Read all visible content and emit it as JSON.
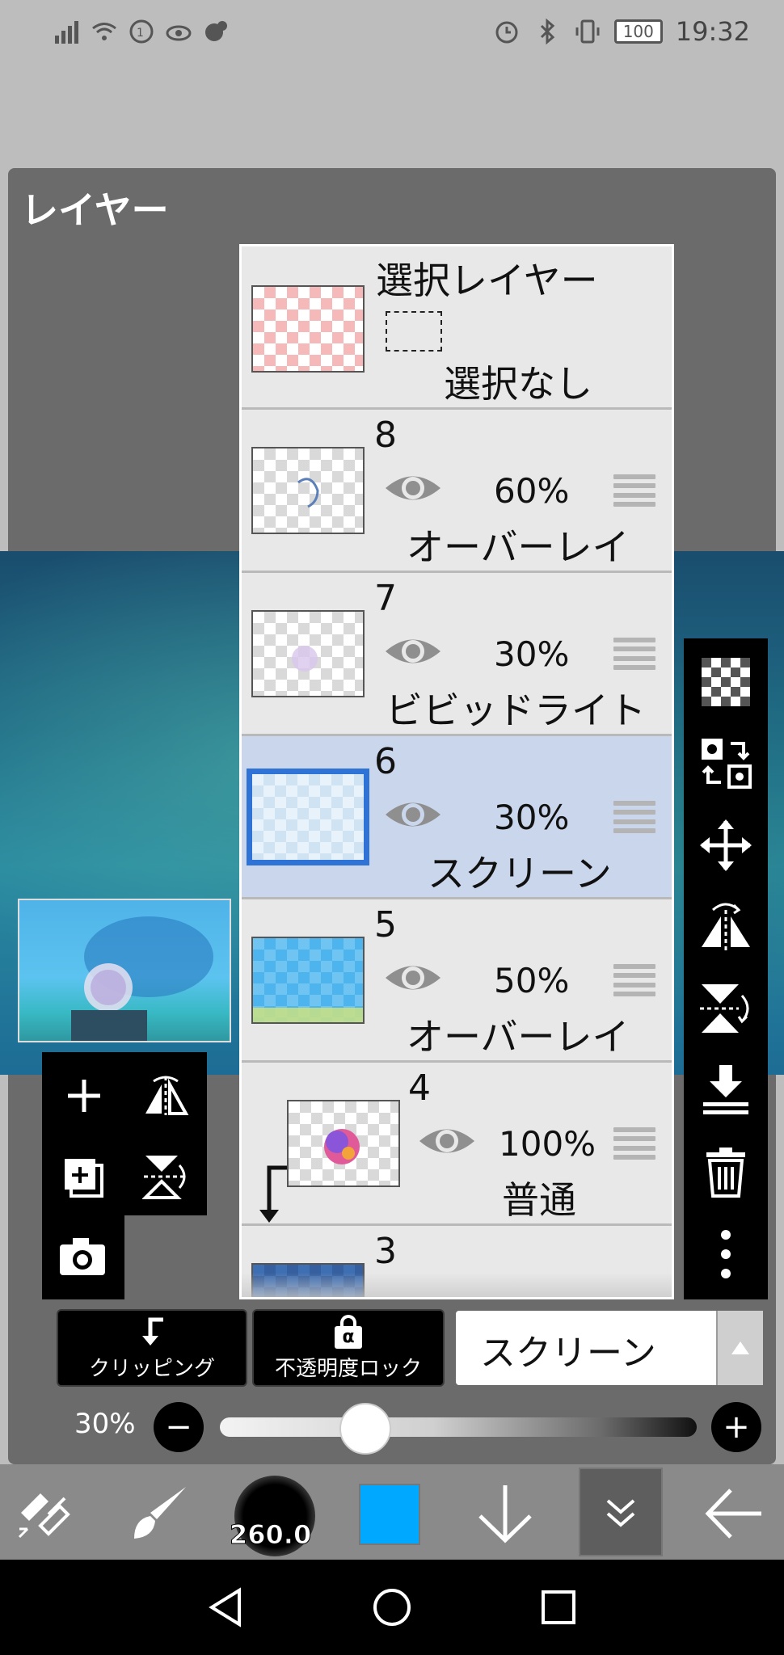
{
  "status_bar": {
    "time": "19:32",
    "battery": "100"
  },
  "panel": {
    "title": "レイヤー"
  },
  "layers": [
    {
      "id": "selection",
      "title": "選択レイヤー",
      "sub": "選択なし"
    },
    {
      "id": "8",
      "number": "8",
      "opacity": "60%",
      "blend": "オーバーレイ"
    },
    {
      "id": "7",
      "number": "7",
      "opacity": "30%",
      "blend": "ビビッドライト"
    },
    {
      "id": "6",
      "number": "6",
      "opacity": "30%",
      "blend": "スクリーン",
      "selected": true
    },
    {
      "id": "5",
      "number": "5",
      "opacity": "50%",
      "blend": "オーバーレイ"
    },
    {
      "id": "4",
      "number": "4",
      "opacity": "100%",
      "blend": "普通",
      "clipped": true
    },
    {
      "id": "3",
      "number": "3"
    }
  ],
  "buttons": {
    "clipping": "クリッピング",
    "lock_alpha": "不透明度ロック",
    "alpha_symbol": "α"
  },
  "blend_select": {
    "value": "スクリーン"
  },
  "opacity_slider": {
    "label": "30%",
    "value": 0.3,
    "minus": "−",
    "plus": "+"
  },
  "bottom_toolbar": {
    "brush_size": "260.0",
    "color": "#00a8ff"
  },
  "icons": {
    "right_toolbar": [
      "transparent-grid-icon",
      "reference-icon",
      "move-icon",
      "flip-horizontal-icon",
      "flip-vertical-icon",
      "merge-down-icon",
      "trash-icon",
      "more-vertical-icon"
    ],
    "left_toolbar": [
      "add-layer-icon",
      "flip-h-rotate-icon",
      "duplicate-layer-icon",
      "flip-v-rotate-icon",
      "camera-icon"
    ]
  }
}
